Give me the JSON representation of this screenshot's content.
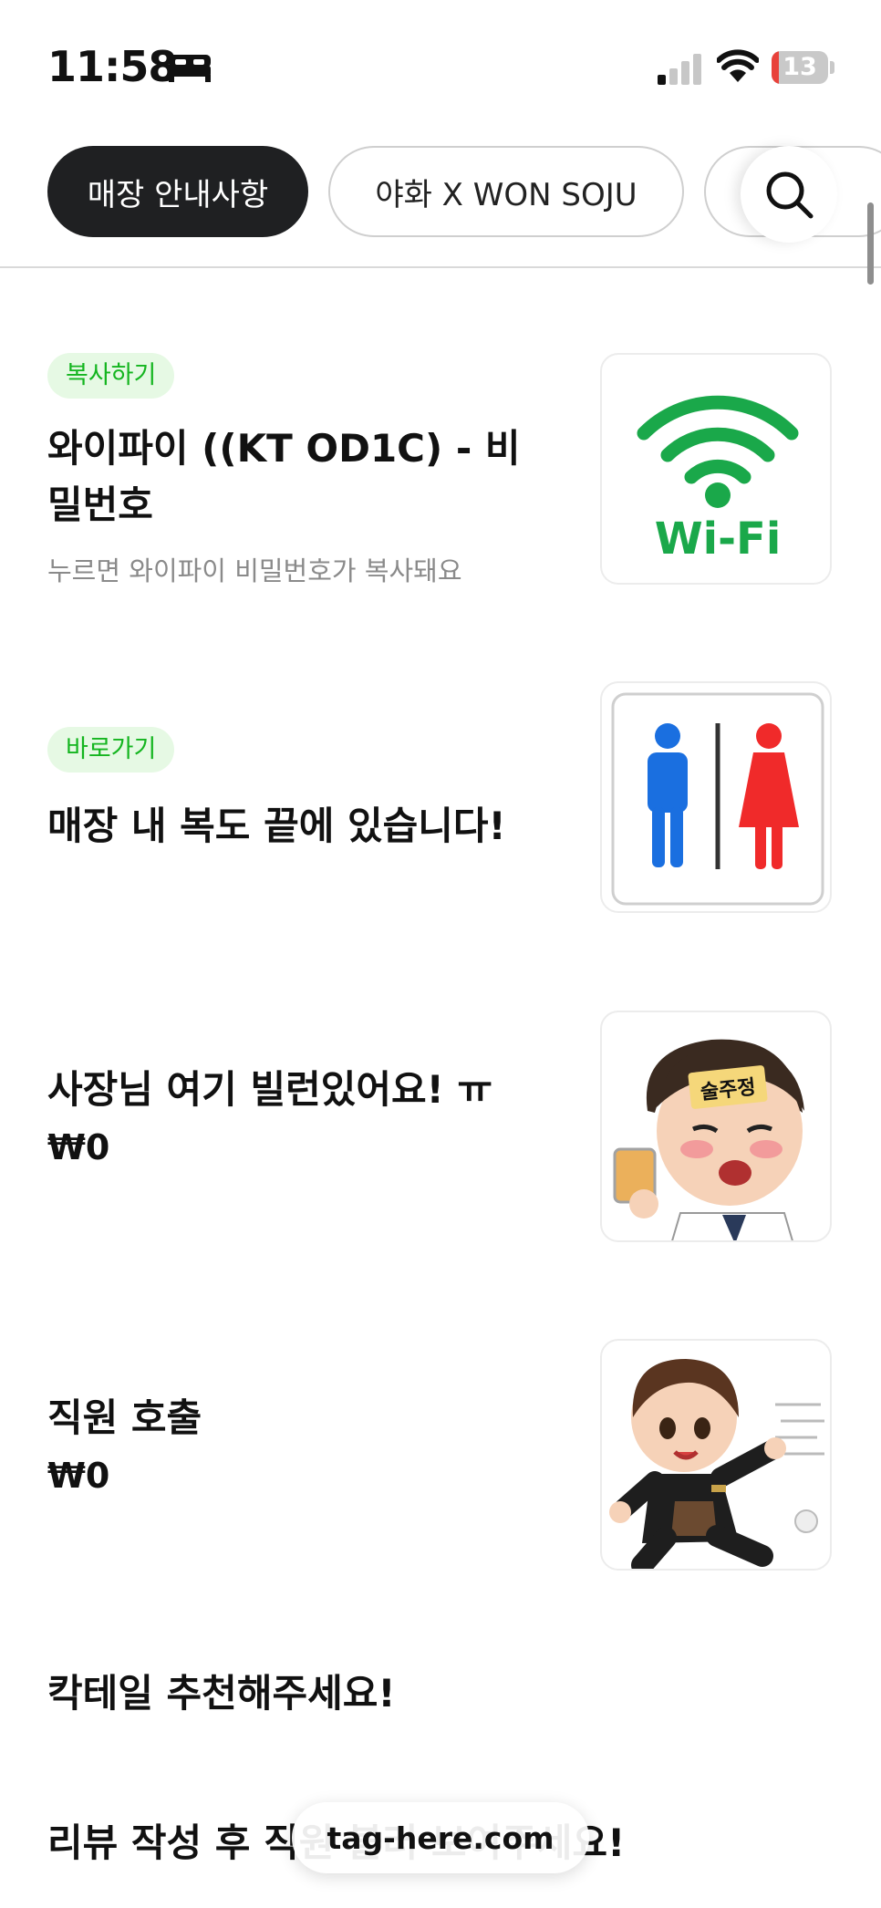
{
  "status_bar": {
    "time": "11:58",
    "battery_level": "13",
    "battery_percent": 0.13,
    "icons": [
      "bed-icon",
      "cellular-signal-icon",
      "wifi-icon",
      "battery-icon"
    ]
  },
  "tabs": [
    {
      "label": "매장 안내사항",
      "active": true
    },
    {
      "label": "야화 X WON SOJU",
      "active": false
    },
    {
      "label": "",
      "active": false
    }
  ],
  "search": {
    "icon": "search-icon"
  },
  "items": [
    {
      "badge": "복사하기",
      "title": "와이파이 ((KT OD1C) - 비밀번호",
      "desc": "누르면 와이파이 비밀번호가 복사돼요",
      "image": "wifi-logo",
      "image_text": "Wi-Fi"
    },
    {
      "badge": "바로가기",
      "title": "매장 내 복도 끝에 있습니다!",
      "image": "restroom-sign"
    },
    {
      "title": "사장님 여기 빌런있어요! ㅠ",
      "price": "₩0",
      "image": "drunk-cartoon",
      "image_text": "술주정"
    },
    {
      "title": "직원 호출",
      "price": "₩0",
      "image": "running-staff-cartoon"
    },
    {
      "title": "칵테일 추천해주세요!"
    },
    {
      "title": "리뷰 작성 후 직원 불러 보여주세요!"
    }
  ],
  "footer": {
    "url": "tag-here.com"
  },
  "colors": {
    "accent_green": "#14b51f",
    "wifi_green": "#1aa84a",
    "dark_tab": "#1f2022",
    "restroom_male": "#1a6fe0",
    "restroom_female": "#f02a2a"
  }
}
